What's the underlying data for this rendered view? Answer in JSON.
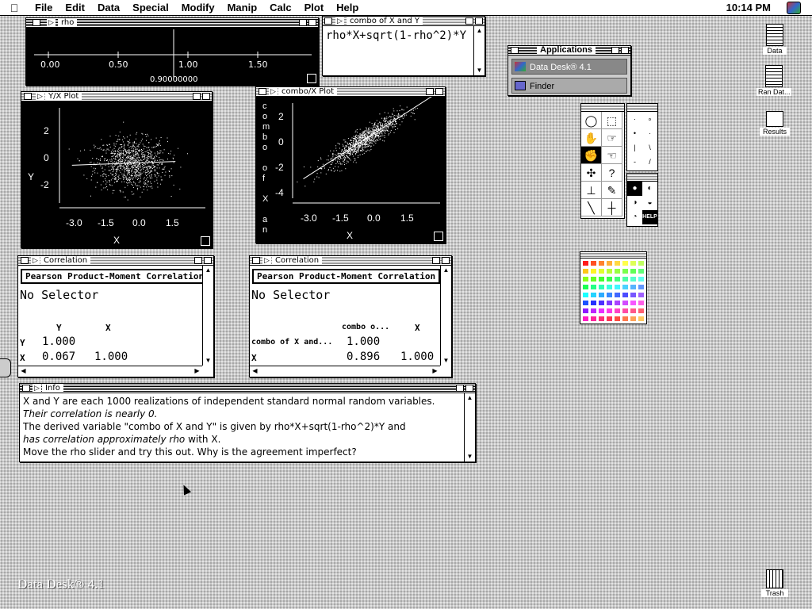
{
  "menubar": {
    "apple": "",
    "items": [
      "File",
      "Edit",
      "Data",
      "Special",
      "Modify",
      "Manip",
      "Calc",
      "Plot",
      "Help"
    ],
    "clock": "10:14 PM"
  },
  "rho_window": {
    "title": "rho",
    "ticks": [
      "0.00",
      "0.50",
      "1.00",
      "1.50"
    ],
    "value": "0.90000000"
  },
  "combo_window": {
    "title": "combo of X and Y",
    "formula": "rho*X+sqrt(1-rho^2)*Y"
  },
  "applications": {
    "title": "Applications",
    "items": [
      "Data Desk® 4.1",
      "Finder"
    ]
  },
  "yx_plot": {
    "title": "Y/X Plot",
    "ylabel": "Y",
    "xlabel": "X",
    "yticks": [
      "2",
      "0",
      "-2"
    ],
    "xticks": [
      "-3.0",
      "-1.5",
      "0.0",
      "1.5"
    ]
  },
  "combo_plot": {
    "title": "combo/X Plot",
    "ylabel": [
      "c",
      "o",
      "m",
      "b",
      "o",
      "",
      "o",
      "f",
      "",
      "X",
      "",
      "a",
      "n"
    ],
    "xlabel": "X",
    "yticks": [
      "2",
      "0",
      "-2",
      "-4"
    ],
    "xticks": [
      "-3.0",
      "-1.5",
      "0.0",
      "1.5"
    ]
  },
  "corr1": {
    "title": "Correlation",
    "heading": "Pearson Product-Moment Correlation",
    "selector": "No Selector",
    "col1": "Y",
    "col2": "X",
    "rows": [
      {
        "label": "Y",
        "v1": "1.000",
        "v2": ""
      },
      {
        "label": "X",
        "v1": "0.067",
        "v2": "1.000"
      }
    ]
  },
  "corr2": {
    "title": "Correlation",
    "heading": "Pearson Product-Moment Correlation",
    "selector": "No Selector",
    "col1": "combo o...",
    "col2": "X",
    "rows": [
      {
        "label": "combo of X and...",
        "v1": "1.000",
        "v2": ""
      },
      {
        "label": "X",
        "v1": "0.896",
        "v2": "1.000"
      }
    ]
  },
  "info": {
    "title": "Info",
    "line1": "X and Y are each 1000 realizations of independent standard normal random variables.",
    "line2": "Their correlation is nearly 0.",
    "line3": "The derived variable \"combo of X and Y\" is given by rho*X+sqrt(1-rho^2)*Y and",
    "line4a": "has correlation approximately rho",
    "line4b": " with X.",
    "line5": "Move the rho slider and try this out. Why is the agreement imperfect?"
  },
  "desktop": {
    "icons": [
      "Data",
      "Ran Dat...",
      "Results",
      "Trash"
    ],
    "splash": "Data Desk® 4.1"
  },
  "tools": {
    "help": "HELP"
  }
}
